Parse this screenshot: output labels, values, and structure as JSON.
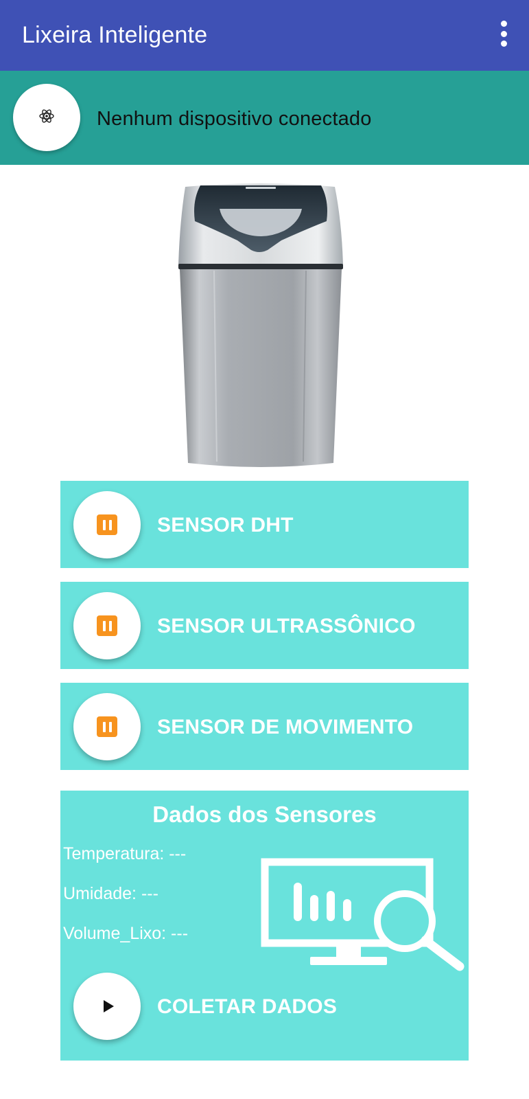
{
  "appbar": {
    "title": "Lixeira Inteligente",
    "menu_icon": "more-vert-icon",
    "color": "#3f51b5"
  },
  "status": {
    "text": "Nenhum dispositivo conectado",
    "icon": "atom-icon",
    "color": "#26a096"
  },
  "image": {
    "subject": "trash-bin-image"
  },
  "sensors": [
    {
      "label": "SENSOR DHT",
      "icon": "pause-icon"
    },
    {
      "label": "SENSOR ULTRASSÔNICO",
      "icon": "pause-icon"
    },
    {
      "label": "SENSOR DE MOVIMENTO",
      "icon": "pause-icon"
    }
  ],
  "data_panel": {
    "title": "Dados dos Sensores",
    "temperature": "Temperatura: ---",
    "humidity": "Umidade: ---",
    "volume": "Volume_Lixo: ---",
    "illustration": "monitor-analytics-icon",
    "collect_label": "COLETAR DADOS",
    "collect_icon": "play-icon"
  },
  "colors": {
    "card": "#69e2dc",
    "pause_accent": "#f7931e",
    "text_on_card": "#ffffff"
  }
}
